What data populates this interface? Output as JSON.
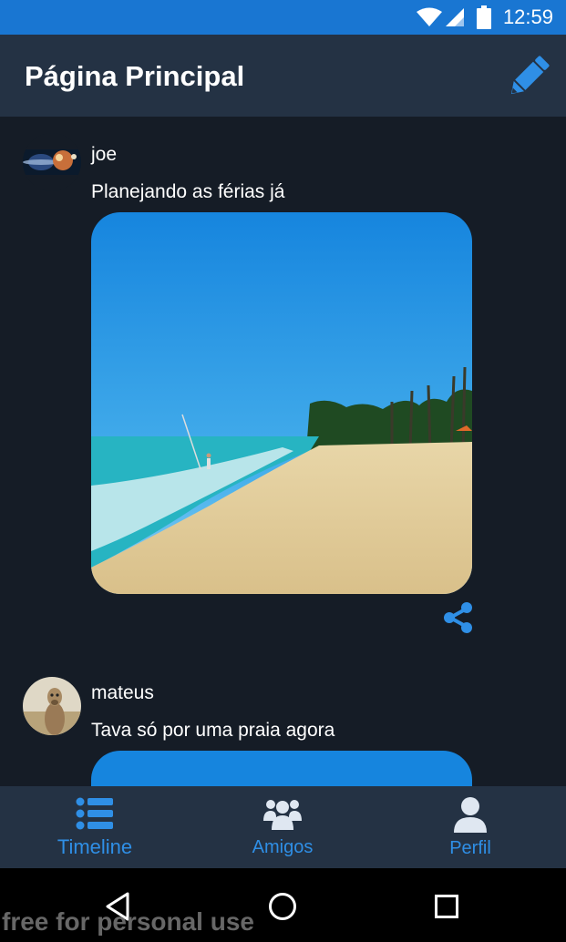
{
  "status_bar": {
    "time": "12:59"
  },
  "app_bar": {
    "title": "Página Principal",
    "edit_icon": "pencil-icon"
  },
  "posts": [
    {
      "username": "joe",
      "text": "Planejando as férias já",
      "avatar": "galaxy-avatar",
      "image": "beach-photo"
    },
    {
      "username": "mateus",
      "text": "Tava só por uma  praia agora",
      "avatar": "meerkat-avatar",
      "image": "sky-photo"
    }
  ],
  "bottom_nav": {
    "items": [
      {
        "label": "Timeline",
        "icon": "list-icon"
      },
      {
        "label": "Amigos",
        "icon": "group-icon"
      },
      {
        "label": "Perfil",
        "icon": "user-icon"
      }
    ]
  },
  "watermark": "free for personal use",
  "colors": {
    "status_bar": "#1976d2",
    "app_bar": "#243244",
    "background": "#151c26",
    "accent": "#2f8fe6"
  }
}
